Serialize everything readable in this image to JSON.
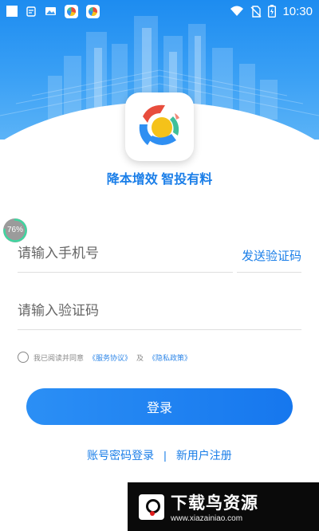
{
  "status_bar": {
    "time": "10:30",
    "left_icons": [
      "square-icon",
      "clipboard-icon",
      "image-icon",
      "app-icon",
      "app-icon"
    ],
    "right_icons": [
      "wifi-icon",
      "no-sim-icon",
      "battery-icon"
    ]
  },
  "brand": {
    "slogan": "降本增效 智投有料"
  },
  "overlay": {
    "progress_text": "76%",
    "progress_value": 0.76
  },
  "form": {
    "phone_placeholder": "请输入手机号",
    "code_placeholder": "请输入验证码",
    "send_code_label": "发送验证码",
    "agree_prefix": "我已阅读并同意",
    "service_link": "《服务协议》",
    "agree_and": "及",
    "privacy_link": "《隐私政策》",
    "login_label": "登录"
  },
  "links": {
    "password_login": "账号密码登录",
    "separator": "|",
    "register": "新用户注册"
  },
  "watermark": {
    "title": "下载鸟资源",
    "url": "www.xiazainiao.com"
  },
  "colors": {
    "primary": "#1a7ee8",
    "header": "#1d8cf0",
    "button": "#2b8ff5"
  }
}
